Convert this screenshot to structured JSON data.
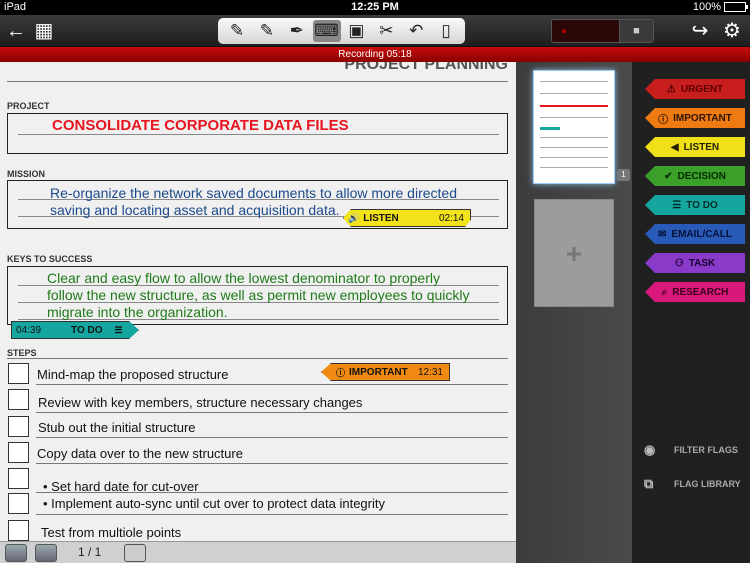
{
  "statusbar": {
    "carrier": "iPad",
    "time": "12:25 PM",
    "battery": "100%"
  },
  "toolbar": {
    "back": "←",
    "grid": "▦",
    "tools": [
      {
        "name": "pen-tool-icon",
        "glyph": "✎",
        "active": false
      },
      {
        "name": "highlighter-tool-icon",
        "glyph": "✎",
        "active": false
      },
      {
        "name": "calligraphy-pen-icon",
        "glyph": "✒",
        "active": false
      },
      {
        "name": "keyboard-icon",
        "glyph": "⌨",
        "active": true
      },
      {
        "name": "image-icon",
        "glyph": "▣",
        "active": false
      },
      {
        "name": "scissors-icon",
        "glyph": "✂",
        "active": false
      },
      {
        "name": "undo-icon",
        "glyph": "↶",
        "active": false
      },
      {
        "name": "page-icon",
        "glyph": "▯",
        "active": false
      }
    ],
    "share": "↪",
    "settings": "⚙"
  },
  "recording": {
    "label": "Recording 05:18"
  },
  "document": {
    "title": "PROJECT PLANNING",
    "project_label": "PROJECT",
    "project_text": "CONSOLIDATE CORPORATE DATA FILES",
    "mission_label": "MISSION",
    "mission_lines": [
      "Re-organize the network saved documents to allow more directed",
      "saving and locating asset and acquisition data."
    ],
    "keys_label": "KEYS TO SUCCESS",
    "keys_lines": [
      "Clear and easy flow to allow the lowest denominator to properly",
      "follow the new structure, as well as permit new employees to quickly",
      "migrate into the organization."
    ],
    "steps_label": "STEPS",
    "steps": [
      "Mind-map the proposed structure",
      "Review with key members, structure necessary changes",
      "Stub out the initial structure",
      "Copy data over to the new structure",
      "• Set hard date for cut-over",
      "• Implement auto-sync until cut over to protect data integrity",
      "Test from multiole points"
    ],
    "flags": {
      "listen": {
        "label": "LISTEN",
        "time": "02:14",
        "color": "#f2e21a"
      },
      "todo": {
        "label": "TO DO",
        "time": "04:39",
        "color": "#16a6a0"
      },
      "important": {
        "label": "IMPORTANT",
        "time": "12:31",
        "color": "#f08a12"
      }
    }
  },
  "pager": {
    "count": "1 / 1"
  },
  "pages": {
    "page_number": "1",
    "add_label": "+"
  },
  "flag_panel": {
    "flags": [
      {
        "label": "URGENT",
        "icon": "⚠",
        "color": "#c81e1e",
        "text": "#5a0000"
      },
      {
        "label": "IMPORTANT",
        "icon": "ⓘ",
        "color": "#f07a12",
        "text": "#2a1400"
      },
      {
        "label": "LISTEN",
        "icon": "◀",
        "color": "#f0e01a",
        "text": "#222200"
      },
      {
        "label": "DECISION",
        "icon": "✔",
        "color": "#3aa02a",
        "text": "#062a00"
      },
      {
        "label": "TO DO",
        "icon": "☰",
        "color": "#16a6a0",
        "text": "#002a28"
      },
      {
        "label": "EMAIL/CALL",
        "icon": "✉",
        "color": "#2a5ab8",
        "text": "#021238"
      },
      {
        "label": "TASK",
        "icon": "⚇",
        "color": "#8a3ac8",
        "text": "#1a0030"
      },
      {
        "label": "RESEARCH",
        "icon": "⌕",
        "color": "#d8187a",
        "text": "#38001a"
      }
    ],
    "filter_label": "FILTER FLAGS",
    "library_label": "FLAG LIBRARY"
  }
}
